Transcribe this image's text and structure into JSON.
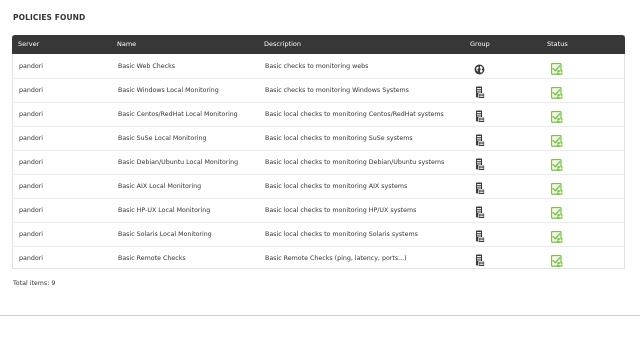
{
  "section": {
    "title": "POLICIES FOUND"
  },
  "table": {
    "headers": {
      "server": "Server",
      "name": "Name",
      "description": "Description",
      "group": "Group",
      "status": "Status"
    },
    "rows": [
      {
        "server": "pandori",
        "name": "Basic Web Checks",
        "description": "Basic checks to monitoring webs",
        "group_icon": "globe-icon",
        "status_icon": "status-ok-icon"
      },
      {
        "server": "pandori",
        "name": "Basic Windows Local Monitoring",
        "description": "Basic checks to monitoring Windows Systems",
        "group_icon": "server-group-icon",
        "status_icon": "status-ok-icon"
      },
      {
        "server": "pandori",
        "name": "Basic Centos/RedHat Local Monitoring",
        "description": "Basic local checks to monitoring Centos/RedHat systems",
        "group_icon": "server-group-icon",
        "status_icon": "status-ok-icon"
      },
      {
        "server": "pandori",
        "name": "Basic SuSe Local Monitoring",
        "description": "Basic local checks to monitoring SuSe systems",
        "group_icon": "server-group-icon",
        "status_icon": "status-ok-icon"
      },
      {
        "server": "pandori",
        "name": "Basic Debian/Ubuntu Local Monitoring",
        "description": "Basic local checks to monitoring Debian/Ubuntu systems",
        "group_icon": "server-group-icon",
        "status_icon": "status-ok-icon"
      },
      {
        "server": "pandori",
        "name": "Basic AIX Local Monitoring",
        "description": "Basic local checks to monitoring AIX systems",
        "group_icon": "server-group-icon",
        "status_icon": "status-ok-icon"
      },
      {
        "server": "pandori",
        "name": "Basic HP-UX Local Monitoring",
        "description": "Basic local checks to monitoring HP/UX systems",
        "group_icon": "server-group-icon",
        "status_icon": "status-ok-icon"
      },
      {
        "server": "pandori",
        "name": "Basic Solaris Local Monitoring",
        "description": "Basic local checks to monitoring Solaris systems",
        "group_icon": "server-group-icon",
        "status_icon": "status-ok-icon"
      },
      {
        "server": "pandori",
        "name": "Basic Remote Checks",
        "description": "Basic Remote Checks (ping, latency, ports...)",
        "group_icon": "server-group-icon",
        "status_icon": "status-ok-icon"
      }
    ]
  },
  "footer": {
    "total_label": "Total items: 9"
  },
  "colors": {
    "header_bg": "#373737",
    "status_green": "#7cc242",
    "group_icon_dark": "#3a3a3a"
  }
}
